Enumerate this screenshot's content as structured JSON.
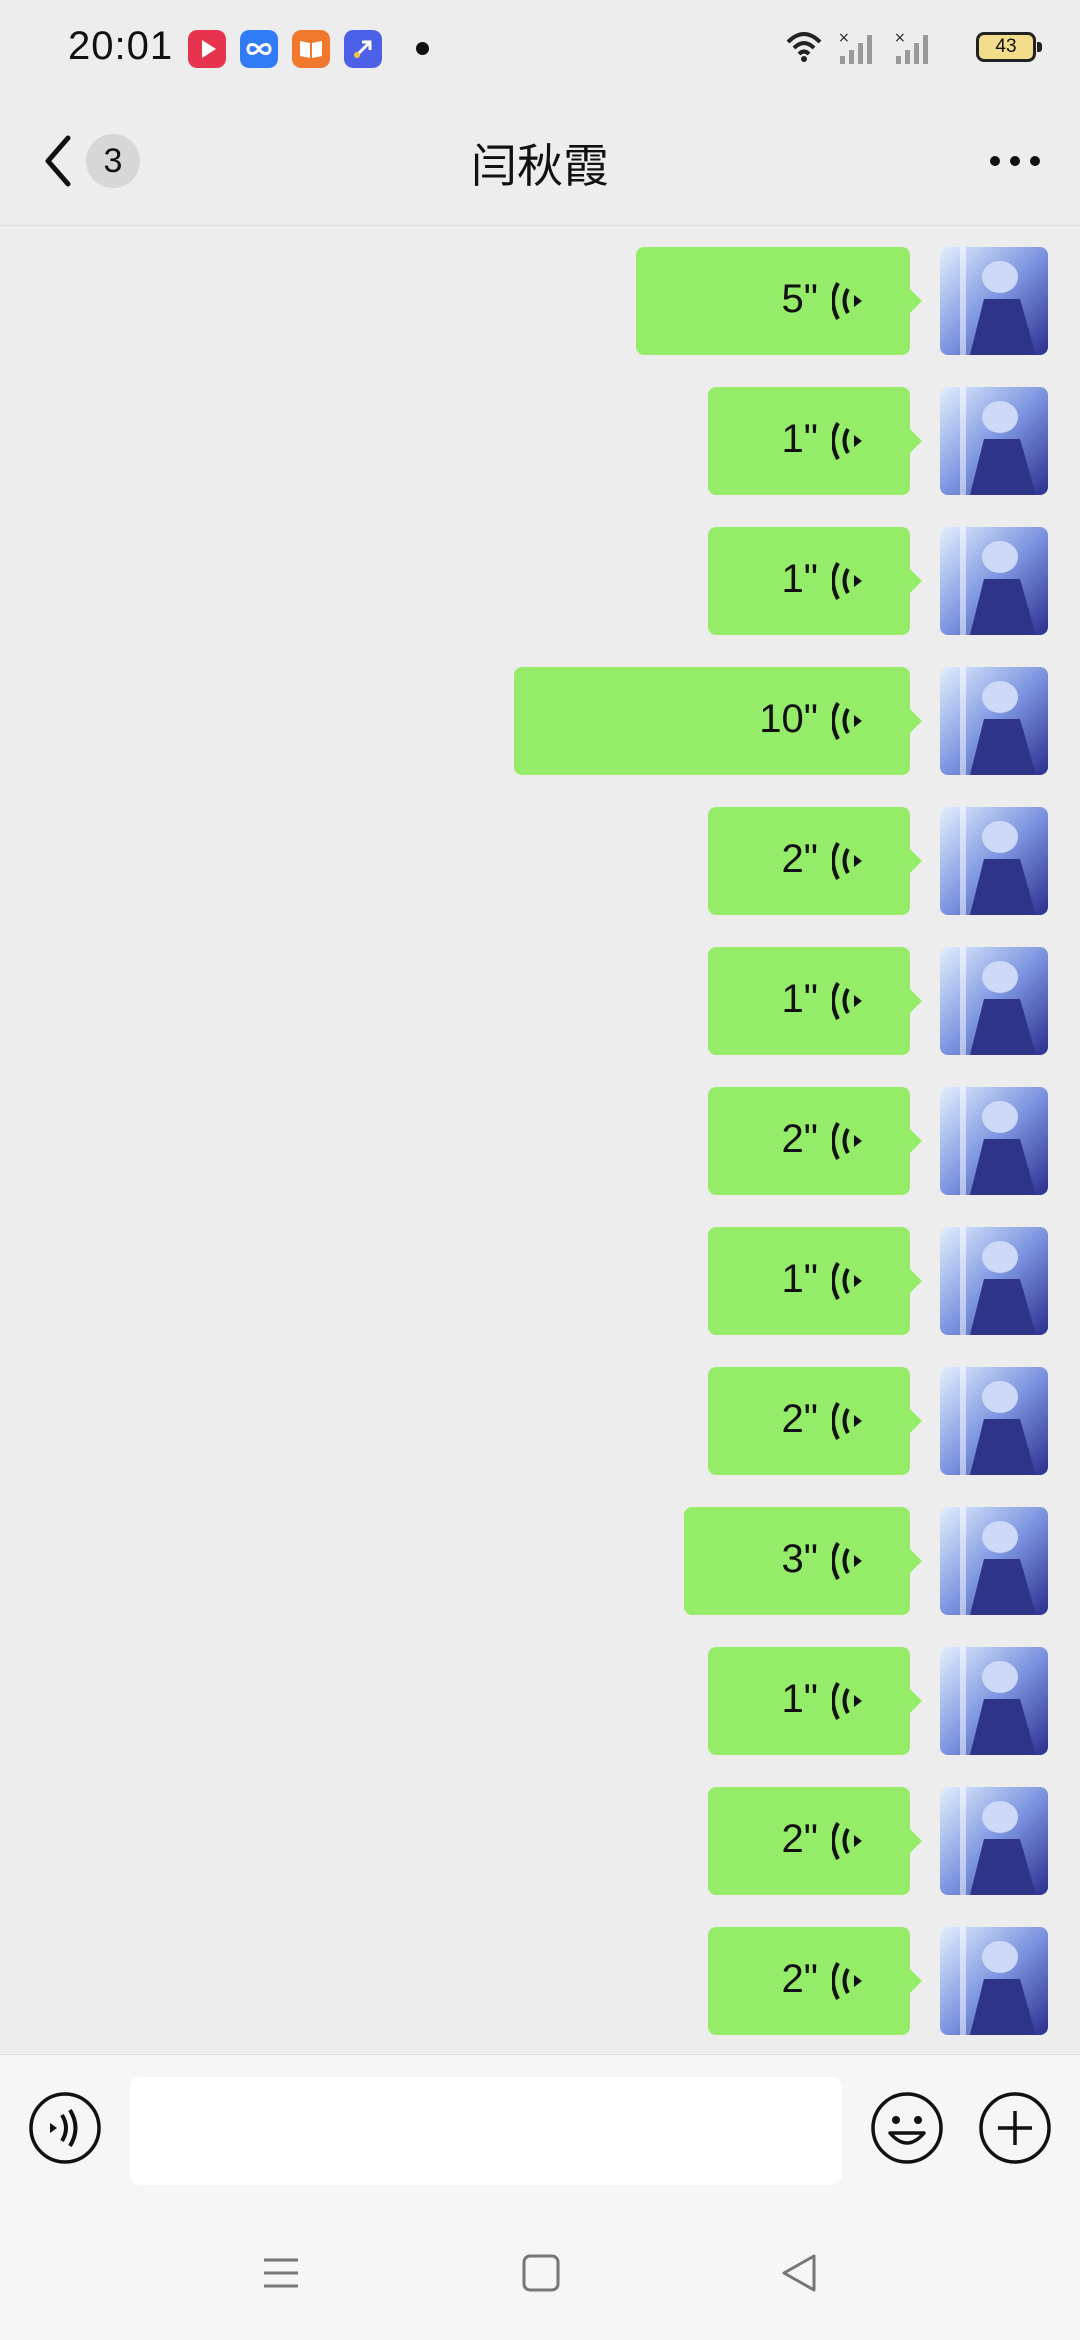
{
  "status_bar": {
    "time": "20:01",
    "battery": "43",
    "app_icons": [
      {
        "name": "video-app-icon",
        "color": "#e8334f"
      },
      {
        "name": "infinity-app-icon",
        "color": "#2f7cf6"
      },
      {
        "name": "book-app-icon",
        "color": "#f0792d"
      },
      {
        "name": "shortcut-app-icon",
        "color": "#4d61e8"
      }
    ]
  },
  "header": {
    "unread_count": "3",
    "title": "闫秋霞"
  },
  "messages": [
    {
      "duration": "5\""
    },
    {
      "duration": "1\""
    },
    {
      "duration": "1\""
    },
    {
      "duration": "10\""
    },
    {
      "duration": "2\""
    },
    {
      "duration": "1\""
    },
    {
      "duration": "2\""
    },
    {
      "duration": "1\""
    },
    {
      "duration": "2\""
    },
    {
      "duration": "3\""
    },
    {
      "duration": "1\""
    },
    {
      "duration": "2\""
    },
    {
      "duration": "2\""
    }
  ],
  "input": {
    "value": "",
    "placeholder": ""
  },
  "colors": {
    "background": "#ededed",
    "bubble": "#95ec69",
    "input_bar": "#f6f6f6"
  }
}
